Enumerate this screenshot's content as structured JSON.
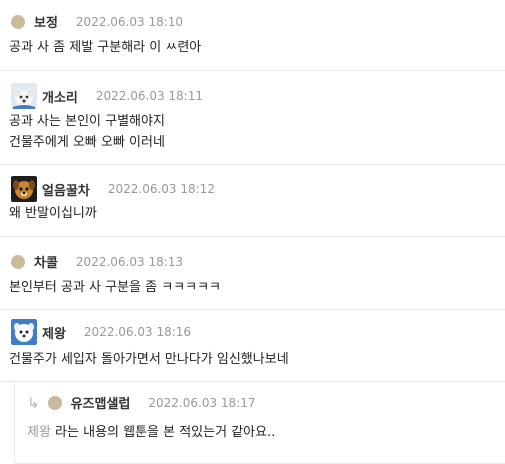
{
  "comments": [
    {
      "nick": "보정",
      "date": "2022.06.03 18:10",
      "avatar": "dot",
      "lines": [
        "공과 사 좀 제발 구분해라 이 ㅆ련아"
      ]
    },
    {
      "nick": "개소리",
      "date": "2022.06.03 18:11",
      "avatar": "white-dog-icon",
      "lines": [
        "공과 사는 본인이 구별해야지",
        "건물주에게 오빠 오빠 이러네"
      ]
    },
    {
      "nick": "얼음꿀차",
      "date": "2022.06.03 18:12",
      "avatar": "brown-dog-icon",
      "lines": [
        "왜 반말이십니까"
      ]
    },
    {
      "nick": "차콜",
      "date": "2022.06.03 18:13",
      "avatar": "dot",
      "lines": [
        "본인부터 공과 사 구분을 좀 ㅋㅋㅋㅋㅋ"
      ]
    },
    {
      "nick": "제왕",
      "date": "2022.06.03 18:16",
      "avatar": "white-puppy-icon",
      "lines": [
        "건물주가 세입자 돌아가면서 만나다가 임신했나보네"
      ]
    }
  ],
  "reply": {
    "nick": "유즈맵샐럽",
    "date": "2022.06.03 18:17",
    "avatar": "dot",
    "mention": "제왕",
    "text": " 라는 내용의 웹툰을 본 적있는거 같아요.."
  },
  "colors": {
    "date": "#999999",
    "divider": "#e9e9e9",
    "avatar_dot": "#c9b99d"
  }
}
